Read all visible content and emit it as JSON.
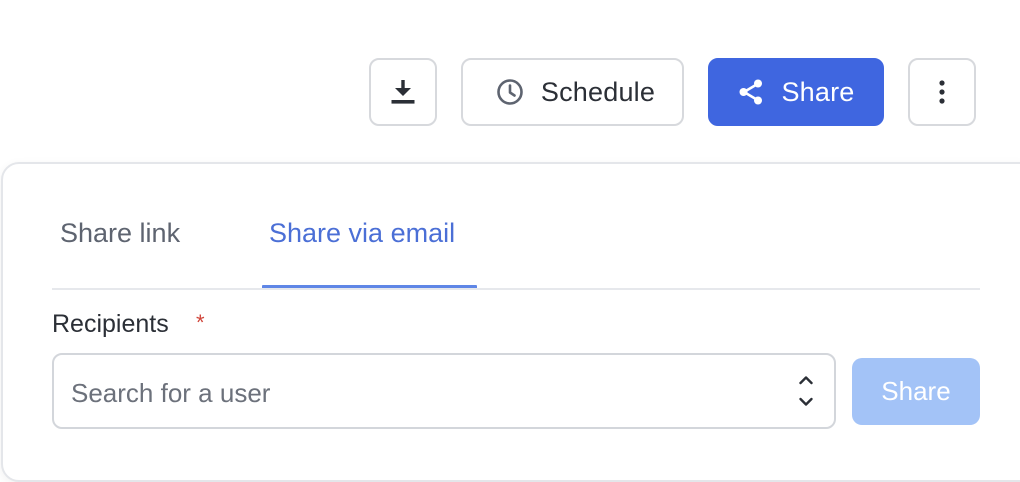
{
  "toolbar": {
    "download_icon": "download-icon",
    "schedule_icon": "clock-icon",
    "schedule_label": "Schedule",
    "share_icon": "share-icon",
    "share_label": "Share",
    "more_icon": "vertical-ellipsis-icon"
  },
  "share_panel": {
    "tabs": [
      {
        "label": "Share link",
        "active": false
      },
      {
        "label": "Share via email",
        "active": true
      }
    ],
    "recipients": {
      "label": "Recipients",
      "required_marker": "*",
      "placeholder": "Search for a user",
      "chevron_icon": "chevron-up-down-icon"
    },
    "submit_label": "Share",
    "submit_disabled": true
  },
  "colors": {
    "primary": "#3f66e0",
    "active_tab": "#4b6fd6",
    "disabled_button": "#a3c3f7",
    "required": "#d0453a"
  }
}
